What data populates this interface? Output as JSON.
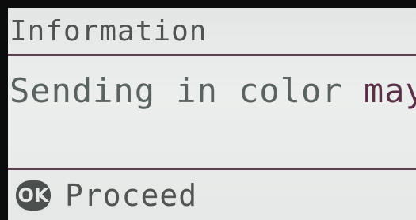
{
  "screen": {
    "title": "Information",
    "message_main": "Sending in color ",
    "message_tail": "may take",
    "ok_icon_label": "OK",
    "proceed_label": "Proceed"
  }
}
